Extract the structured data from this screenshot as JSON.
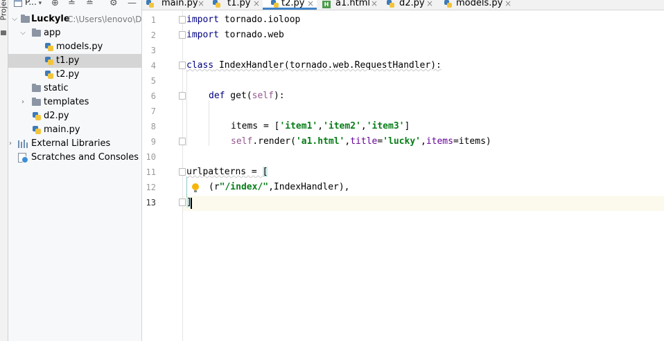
{
  "tool_strip": {
    "label": "Project"
  },
  "project_panel": {
    "title": "P...",
    "tree": [
      {
        "label": "Luckyle",
        "path": "C:\\Users\\lenovo\\D"
      },
      {
        "label": "app"
      },
      {
        "label": "models.py"
      },
      {
        "label": "t1.py",
        "selected": true
      },
      {
        "label": "t2.py"
      },
      {
        "label": "static"
      },
      {
        "label": "templates"
      },
      {
        "label": "d2.py"
      },
      {
        "label": "main.py"
      },
      {
        "label": "External Libraries"
      },
      {
        "label": "Scratches and Consoles"
      }
    ]
  },
  "tabs": [
    {
      "label": "main.py"
    },
    {
      "label": "t1.py"
    },
    {
      "label": "t2.py",
      "active": true
    },
    {
      "label": "a1.html"
    },
    {
      "label": "d2.py"
    },
    {
      "label": "models.py"
    }
  ],
  "editor": {
    "line_numbers": [
      "1",
      "2",
      "3",
      "4",
      "5",
      "6",
      "7",
      "8",
      "9",
      "10",
      "11",
      "12",
      "13"
    ],
    "code": {
      "l1_kw": "import",
      "l1_rest": " tornado.ioloop",
      "l2_kw": "import",
      "l2_rest": " tornado.web",
      "l4_kw": "class",
      "l4_rest": " IndexHandler(tornado.web.RequestHandler):",
      "l6_kw": "def",
      "l6_name": " get(",
      "l6_self": "self",
      "l6_end": "):",
      "l8_a": "items = [",
      "l8_s1": "'item1'",
      "l8_c1": ",",
      "l8_s2": "'item2'",
      "l8_c2": ",",
      "l8_s3": "'item3'",
      "l8_b": "]",
      "l9_self": "self",
      "l9_a": ".render(",
      "l9_s1": "'a1.html'",
      "l9_c1": ",",
      "l9_p1": "title",
      "l9_eq1": "=",
      "l9_s2": "'lucky'",
      "l9_c2": ",",
      "l9_p2": "items",
      "l9_eq2": "=items)",
      "l11_a": "urlpatterns = ",
      "l11_b": "[",
      "l12_a": "(r",
      "l12_s": "\"/index/\"",
      "l12_b": ",IndexHandler),",
      "l13_b": "]"
    }
  },
  "colors": {
    "keyword": "#000080",
    "string": "#067d17",
    "self": "#94558d",
    "accent": "#4083c9",
    "current_line": "#fcfaed"
  },
  "icons": [
    "folder-icon",
    "python-file-icon",
    "html-file-icon",
    "libraries-icon",
    "scratches-icon",
    "settings-icon",
    "locate-icon",
    "collapse-icon",
    "expand-icon",
    "hide-icon",
    "intention-bulb-icon"
  ]
}
